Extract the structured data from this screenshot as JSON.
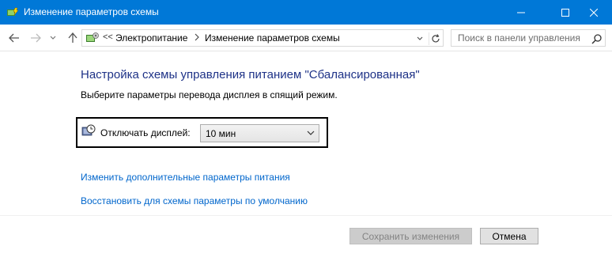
{
  "window": {
    "title": "Изменение параметров схемы",
    "icon": "power-options-icon"
  },
  "nav": {
    "breadcrumb_prefix": "<<",
    "breadcrumb": [
      "Электропитание",
      "Изменение параметров схемы"
    ],
    "search_placeholder": "Поиск в панели управления"
  },
  "content": {
    "heading": "Настройка схемы управления питанием \"Сбалансированная\"",
    "subtitle": "Выберите параметры перевода дисплея в спящий режим.",
    "display_setting": {
      "label": "Отключать дисплей:",
      "value": "10 мин"
    },
    "links": [
      "Изменить дополнительные параметры питания",
      "Восстановить для схемы параметры по умолчанию"
    ]
  },
  "footer": {
    "save_label": "Сохранить изменения",
    "cancel_label": "Отмена"
  },
  "colors": {
    "titlebar": "#0078d7",
    "heading": "#1e3287",
    "link": "#0066cc",
    "highlight_border": "#000000"
  }
}
